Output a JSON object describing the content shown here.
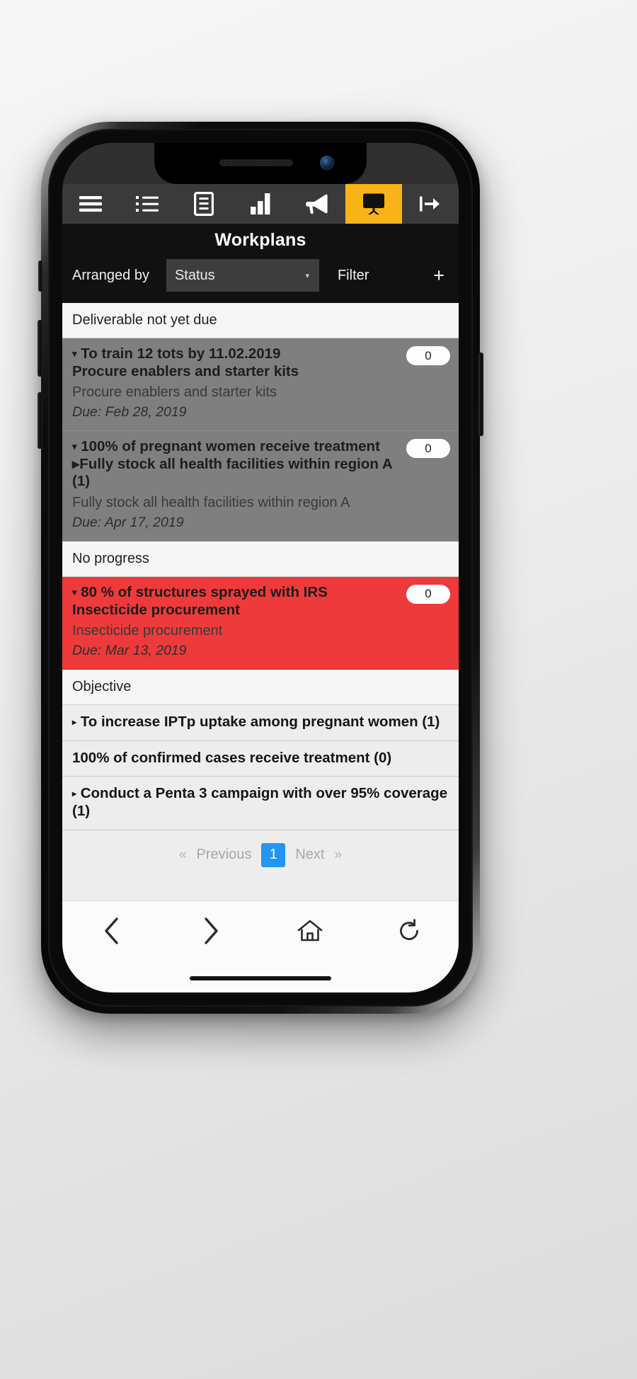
{
  "toolbar": {
    "items": [
      {
        "icon": "hamburger-menu-icon",
        "name": "menu",
        "active": false
      },
      {
        "icon": "task-list-icon",
        "name": "tasks",
        "active": false
      },
      {
        "icon": "document-icon",
        "name": "documents",
        "active": false
      },
      {
        "icon": "bar-chart-icon",
        "name": "reports",
        "active": false
      },
      {
        "icon": "megaphone-icon",
        "name": "announcements",
        "active": false
      },
      {
        "icon": "presentation-board-icon",
        "name": "workplans",
        "active": true
      },
      {
        "icon": "logout-icon",
        "name": "logout",
        "active": false
      }
    ],
    "active_color": "#F8B319"
  },
  "header": {
    "title": "Workplans"
  },
  "controls": {
    "arranged_by_label": "Arranged by",
    "sort_value": "Status",
    "sort_caret": "▾",
    "filter_label": "Filter",
    "add_label": "+"
  },
  "list": {
    "groups": [
      {
        "header": "Deliverable not yet due",
        "items": [
          {
            "caret": "▾",
            "objective": "To train 12 tots by 11.02.2019",
            "title": "Procure enablers and starter kits",
            "subtitle": "Procure enablers and starter kits",
            "due": "Due: Feb 28, 2019",
            "badge": "0",
            "style": "gray"
          },
          {
            "caret": "▾",
            "objective": "100% of pregnant women receive treatment",
            "title": "▸Fully stock all health facilities within region A (1)",
            "subtitle": "Fully stock all health facilities within region A",
            "due": "Due: Apr 17, 2019",
            "badge": "0",
            "style": "gray"
          }
        ]
      },
      {
        "header": "No progress",
        "items": [
          {
            "caret": "▾",
            "objective": "80 % of structures sprayed with IRS",
            "title": "Insecticide procurement",
            "subtitle": "Insecticide procurement",
            "due": "Due: Mar 13, 2019",
            "badge": "0",
            "style": "red"
          }
        ]
      },
      {
        "header": "Objective",
        "objectives": [
          {
            "caret": "▸",
            "label": "To increase IPTp uptake among pregnant women (1)"
          },
          {
            "caret": "",
            "label": "100% of confirmed cases receive treatment (0)"
          },
          {
            "caret": "▸",
            "label": "Conduct a Penta 3 campaign with over 95% coverage (1)"
          }
        ]
      }
    ]
  },
  "pagination": {
    "first": "«",
    "previous": "Previous",
    "current_page": "1",
    "next": "Next",
    "last": "»"
  },
  "browser_nav": {
    "back": "back-icon",
    "forward": "forward-icon",
    "home": "home-icon",
    "reload": "reload-icon"
  }
}
